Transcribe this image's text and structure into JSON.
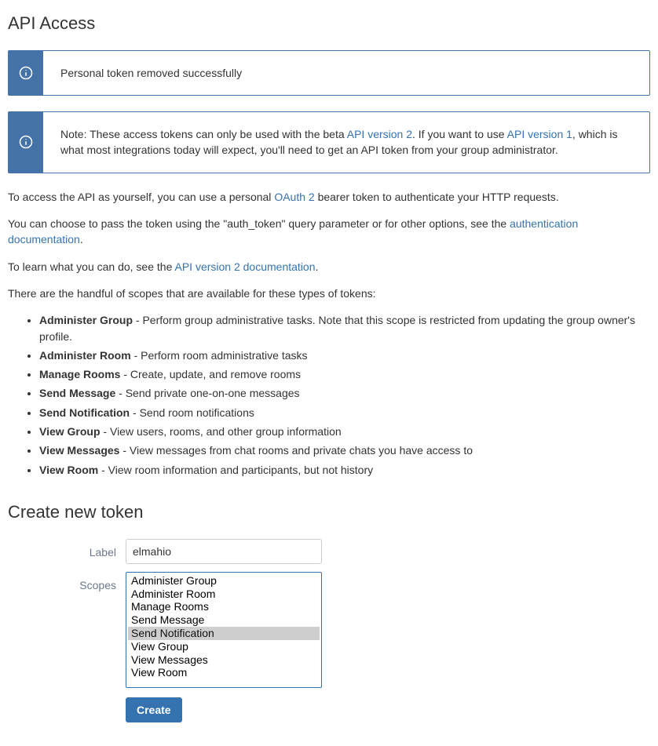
{
  "page_title": "API Access",
  "alerts": {
    "success": "Personal token removed successfully",
    "note_prefix": "Note: These access tokens can only be used with the beta ",
    "note_link1": "API version 2",
    "note_mid1": ". If you want to use ",
    "note_link2": "API version 1",
    "note_mid2": ", which is what most integrations today will expect, you'll need to get an API token from your group administrator."
  },
  "intro": {
    "p1_a": "To access the API as yourself, you can use a personal ",
    "p1_link": "OAuth 2",
    "p1_b": " bearer token to authenticate your HTTP requests.",
    "p2_a": "You can choose to pass the token using the \"auth_token\" query parameter or for other options, see the ",
    "p2_link": "authentication documentation",
    "p2_b": ".",
    "p3_a": "To learn what you can do, see the ",
    "p3_link": "API version 2 documentation",
    "p3_b": ".",
    "p4": "There are the handful of scopes that are available for these types of tokens:"
  },
  "scopes": [
    {
      "name": "Administer Group",
      "desc": " - Perform group administrative tasks. Note that this scope is restricted from updating the group owner's profile."
    },
    {
      "name": "Administer Room",
      "desc": " - Perform room administrative tasks"
    },
    {
      "name": "Manage Rooms",
      "desc": " - Create, update, and remove rooms"
    },
    {
      "name": "Send Message",
      "desc": " - Send private one-on-one messages"
    },
    {
      "name": "Send Notification",
      "desc": " - Send room notifications"
    },
    {
      "name": "View Group",
      "desc": " - View users, rooms, and other group information"
    },
    {
      "name": "View Messages",
      "desc": " - View messages from chat rooms and private chats you have access to"
    },
    {
      "name": "View Room",
      "desc": " - View room information and participants, but not history"
    }
  ],
  "create": {
    "heading": "Create new token",
    "label_label": "Label",
    "label_value": "elmahio",
    "scopes_label": "Scopes",
    "options": [
      "Administer Group",
      "Administer Room",
      "Manage Rooms",
      "Send Message",
      "Send Notification",
      "View Group",
      "View Messages",
      "View Room"
    ],
    "selected_index": 4,
    "button": "Create"
  }
}
